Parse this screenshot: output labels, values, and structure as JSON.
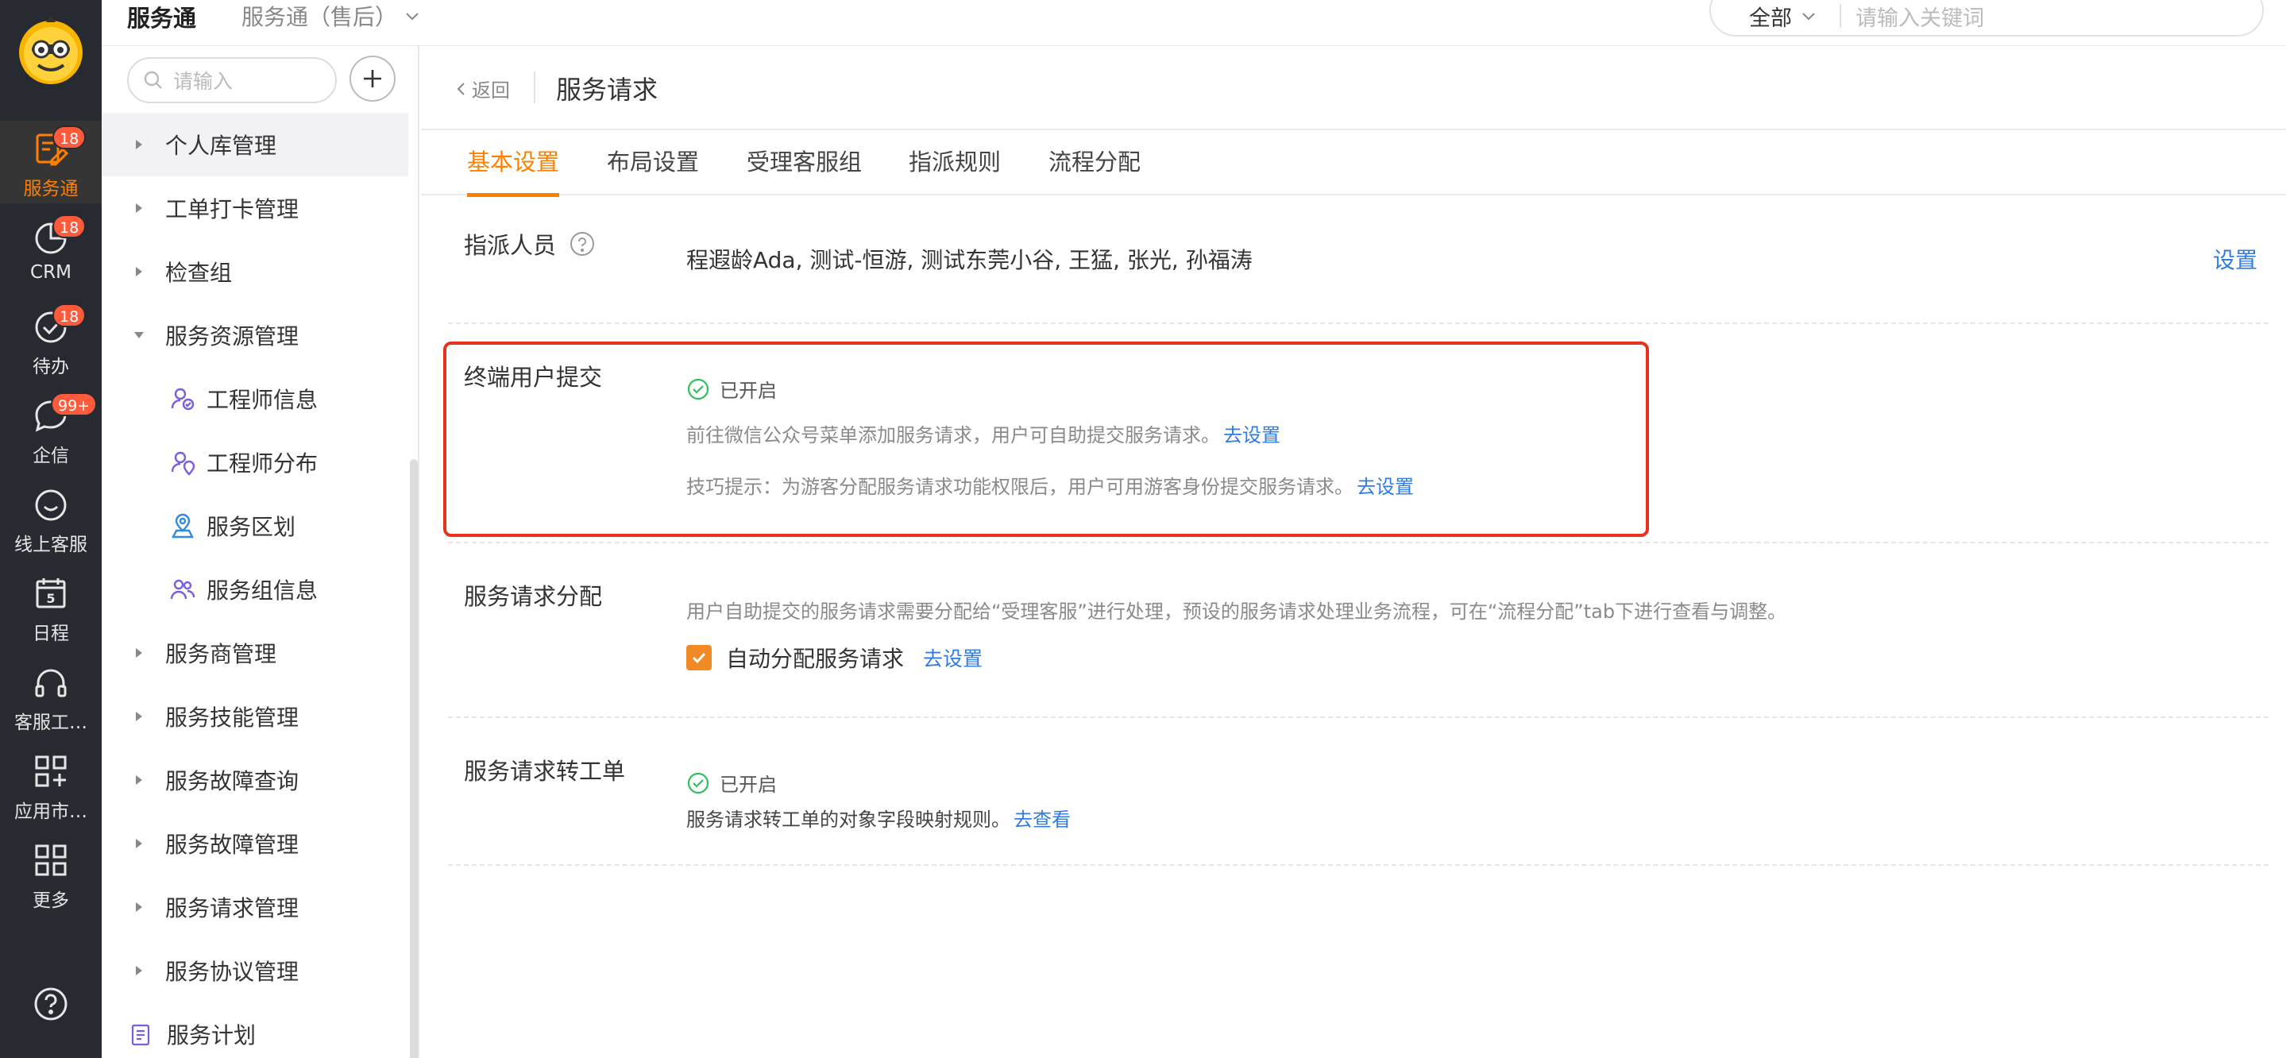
{
  "rail": {
    "items": [
      {
        "label": "服务通",
        "icon": "service-icon",
        "badge": "18",
        "active": true
      },
      {
        "label": "CRM",
        "icon": "pie-chart-icon",
        "badge": "18"
      },
      {
        "label": "待办",
        "icon": "check-circle-icon",
        "badge": "18"
      },
      {
        "label": "企信",
        "icon": "chat-bubble-icon",
        "badge": "99+"
      },
      {
        "label": "线上客服",
        "icon": "smile-icon"
      },
      {
        "label": "日程",
        "icon": "calendar-icon",
        "day": "5"
      },
      {
        "label": "客服工…",
        "icon": "headset-icon"
      },
      {
        "label": "应用市…",
        "icon": "app-grid-plus-icon"
      },
      {
        "label": "更多",
        "icon": "grid-icon"
      }
    ],
    "help_icon": "help-icon"
  },
  "topbar": {
    "app_name": "服务通",
    "app_scope": "服务通（售后）",
    "search_scope": "全部",
    "search_placeholder": "请输入关键词"
  },
  "sidebar": {
    "search_placeholder": "请输入",
    "items": [
      {
        "label": "个人库管理",
        "type": "collapsed",
        "highlight": true
      },
      {
        "label": "工单打卡管理",
        "type": "collapsed"
      },
      {
        "label": "检查组",
        "type": "collapsed"
      },
      {
        "label": "服务资源管理",
        "type": "expanded"
      },
      {
        "label": "工程师信息",
        "type": "child",
        "icon": "engineer-info-icon"
      },
      {
        "label": "工程师分布",
        "type": "child",
        "icon": "engineer-location-icon"
      },
      {
        "label": "服务区划",
        "type": "child",
        "icon": "service-area-icon"
      },
      {
        "label": "服务组信息",
        "type": "child",
        "icon": "service-group-icon"
      },
      {
        "label": "服务商管理",
        "type": "collapsed"
      },
      {
        "label": "服务技能管理",
        "type": "collapsed"
      },
      {
        "label": "服务故障查询",
        "type": "collapsed"
      },
      {
        "label": "服务故障管理",
        "type": "collapsed"
      },
      {
        "label": "服务请求管理",
        "type": "collapsed"
      },
      {
        "label": "服务协议管理",
        "type": "collapsed"
      },
      {
        "label": "服务计划",
        "type": "leaf",
        "icon": "plan-icon"
      }
    ]
  },
  "page": {
    "back_label": "返回",
    "title": "服务请求",
    "tabs": [
      "基本设置",
      "布局设置",
      "受理客服组",
      "指派规则",
      "流程分配"
    ],
    "active_tab": 0
  },
  "sections": {
    "assignees": {
      "label": "指派人员",
      "value": "程遐龄Ada, 测试-恒游, 测试东莞小谷, 王猛, 张光, 孙福涛",
      "action": "设置"
    },
    "end_user_submit": {
      "label": "终端用户提交",
      "status": "已开启",
      "note1": "前往微信公众号菜单添加服务请求，用户可自助提交服务请求。",
      "note1_link": "去设置",
      "note2": "技巧提示：为游客分配服务请求功能权限后，用户可用游客身份提交服务请求。",
      "note2_link": "去设置"
    },
    "request_assign": {
      "label": "服务请求分配",
      "note": "用户自助提交的服务请求需要分配给“受理客服”进行处理，预设的服务请求处理业务流程，可在“流程分配”tab下进行查看与调整。",
      "checkbox_label": "自动分配服务请求",
      "checked": true,
      "link": "去设置"
    },
    "to_workorder": {
      "label": "服务请求转工单",
      "status": "已开启",
      "note": "服务请求转工单的对象字段映射规则。",
      "link": "去查看"
    }
  },
  "colors": {
    "accent": "#ff8000",
    "link": "#2f7be6",
    "highlight_border": "#e8321e",
    "rail_bg": "#272a30",
    "badge": "#ff5a3c",
    "success": "#2fbf5c"
  }
}
